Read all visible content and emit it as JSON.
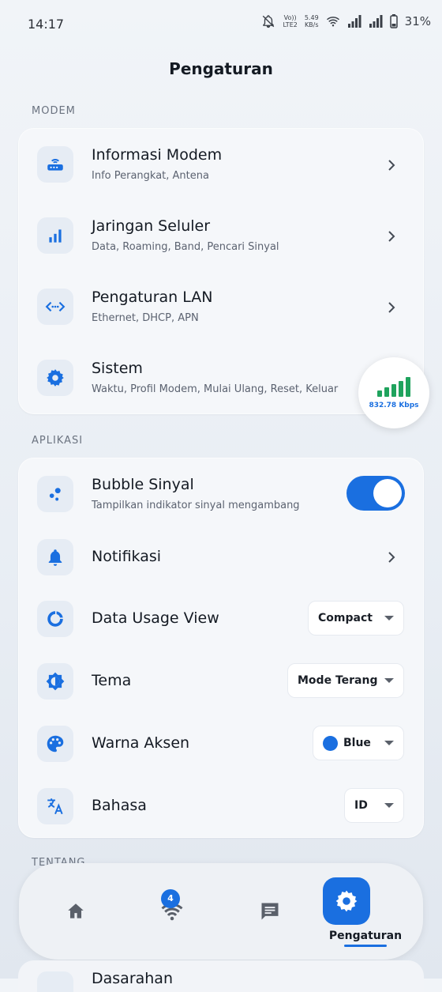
{
  "status_bar": {
    "time": "14:17",
    "volte": "Vo))",
    "lte": "LTE2",
    "speed_value": "5.49",
    "speed_unit": "KB/s",
    "battery": "31%"
  },
  "header": {
    "title": "Pengaturan"
  },
  "sections": {
    "modem": {
      "label": "MODEM",
      "items": [
        {
          "title": "Informasi Modem",
          "subtitle": "Info Perangkat, Antena",
          "icon": "router-icon"
        },
        {
          "title": "Jaringan Seluler",
          "subtitle": "Data, Roaming, Band, Pencari Sinyal",
          "icon": "signal-bars-icon"
        },
        {
          "title": "Pengaturan LAN",
          "subtitle": "Ethernet, DHCP, APN",
          "icon": "lan-icon"
        },
        {
          "title": "Sistem",
          "subtitle": "Waktu, Profil Modem, Mulai Ulang, Reset, Keluar",
          "icon": "gear-icon"
        }
      ]
    },
    "aplikasi": {
      "label": "APLIKASI",
      "bubble": {
        "title": "Bubble Sinyal",
        "subtitle": "Tampilkan indikator sinyal mengambang",
        "enabled": true
      },
      "notifikasi": {
        "title": "Notifikasi"
      },
      "data_usage": {
        "title": "Data Usage View",
        "value": "Compact"
      },
      "tema": {
        "title": "Tema",
        "value": "Mode Terang"
      },
      "warna": {
        "title": "Warna Aksen",
        "value": "Blue",
        "color": "#1a6fe0"
      },
      "bahasa": {
        "title": "Bahasa",
        "value": "ID"
      }
    },
    "tentang": {
      "label": "TENTANG",
      "first_item": "Dasarahan"
    }
  },
  "floating_bubble": {
    "speed": "832.78 Kbps",
    "color": "#1fa35d"
  },
  "bottom_nav": {
    "items": [
      {
        "name": "home",
        "icon": "home-icon"
      },
      {
        "name": "wifi",
        "icon": "wifi-icon",
        "badge": "4"
      },
      {
        "name": "messages",
        "icon": "message-icon"
      },
      {
        "name": "settings",
        "icon": "gear-icon",
        "label": "Pengaturan",
        "active": true
      }
    ]
  },
  "colors": {
    "accent": "#1a6fe0",
    "signal_green": "#1fa35d"
  }
}
